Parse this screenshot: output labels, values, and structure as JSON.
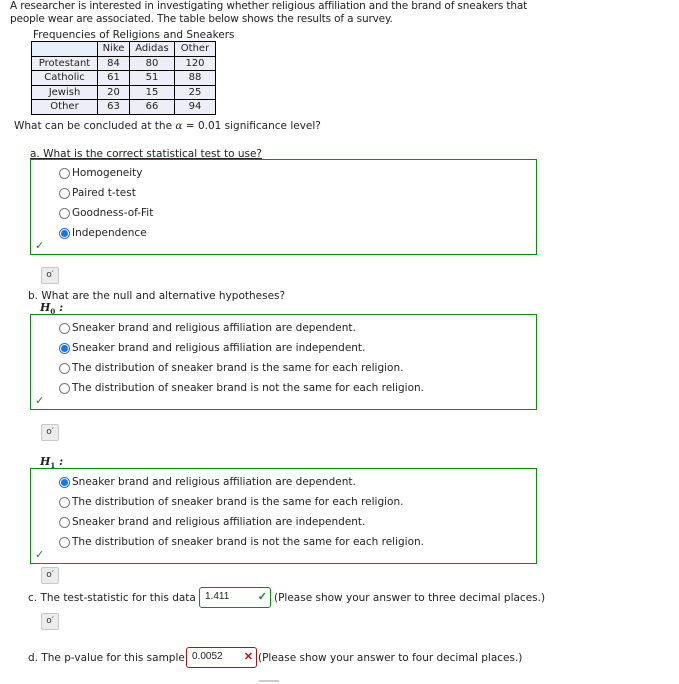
{
  "intro": "A researcher is interested in investigating whether religious affiliation and the brand of sneakers that people wear are associated. The table below shows the results of a survey.",
  "table": {
    "caption": "Frequencies of Religions and Sneakers",
    "columns": [
      "",
      "Nike",
      "Adidas",
      "Other"
    ],
    "rows": [
      {
        "label": "Protestant",
        "values": [
          "84",
          "80",
          "120"
        ]
      },
      {
        "label": "Catholic",
        "values": [
          "61",
          "51",
          "88"
        ]
      },
      {
        "label": "Jewish",
        "values": [
          "20",
          "15",
          "25"
        ]
      },
      {
        "label": "Other",
        "values": [
          "63",
          "66",
          "94"
        ]
      }
    ]
  },
  "question": {
    "prefix": "What can be concluded at the ",
    "alpha_symbol": "α",
    "suffix": " = 0.01 significance level?"
  },
  "part_a": {
    "prompt": "a. What is the correct statistical test to use?",
    "options": [
      "Homogeneity",
      "Paired t-test",
      "Goodness-of-Fit",
      "Independence"
    ],
    "selected_index": 3,
    "status": "correct",
    "check_icon": "✓"
  },
  "part_b": {
    "prompt": "b. What are the null and alternative hypotheses?",
    "h0": {
      "label": "H",
      "sub": "0",
      "colon": " :",
      "options": [
        "Sneaker brand and religious affiliation are dependent.",
        "Sneaker brand and religious affiliation are independent.",
        "The distribution of sneaker brand is the same for each religion.",
        "The distribution of sneaker brand is not the same for each religion."
      ],
      "selected_index": 1,
      "status": "correct"
    },
    "h1": {
      "label": "H",
      "sub": "1",
      "colon": " :",
      "options": [
        "Sneaker brand and religious affiliation are dependent.",
        "The distribution of sneaker brand is the same for each religion.",
        "Sneaker brand and religious affiliation are independent.",
        "The distribution of sneaker brand is not the same for each religion."
      ],
      "selected_index": 0,
      "status": "correct"
    }
  },
  "part_c": {
    "prompt": "c. The test-statistic for this data =",
    "value": "1.411",
    "status": "correct",
    "mark": "✓",
    "hint": "(Please show your answer to three decimal places.)"
  },
  "part_d": {
    "prompt": "d. The p-value for this sample =",
    "value": "0.0052",
    "status": "incorrect",
    "mark": "✕",
    "hint": "(Please show your answer to four decimal places.)"
  },
  "key_icon_glyph": "o′"
}
